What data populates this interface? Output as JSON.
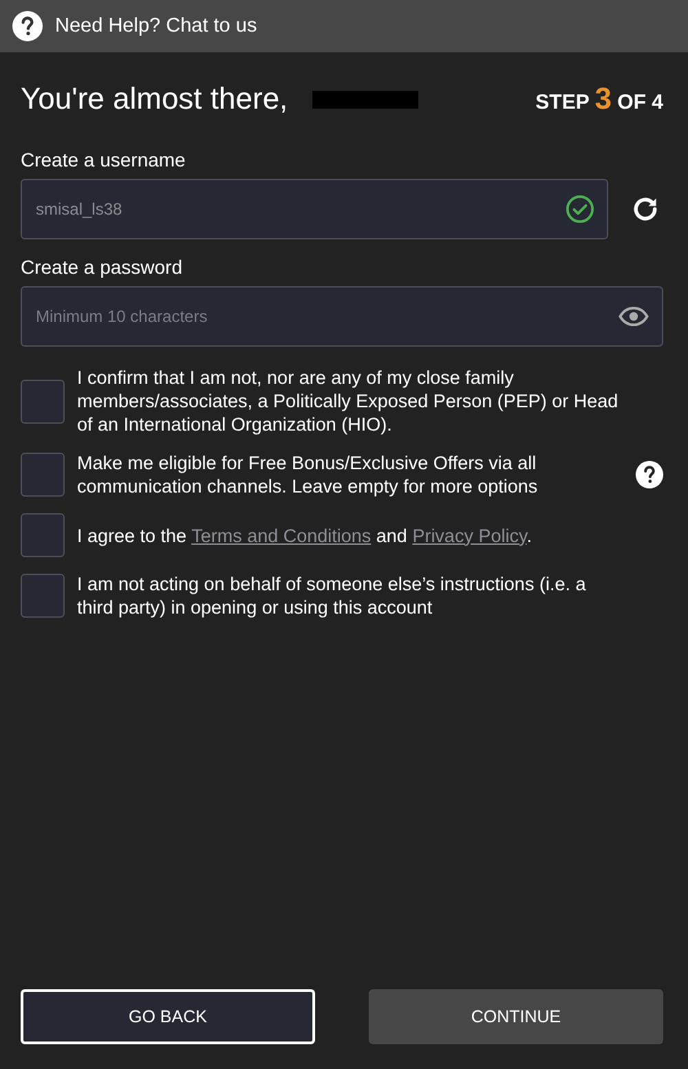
{
  "help_bar": {
    "label": "Need Help? Chat to us"
  },
  "heading": {
    "greeting": "You're almost there,",
    "name_redacted": true,
    "step_prefix": "STEP",
    "step_current": "3",
    "step_suffix": "OF 4"
  },
  "username": {
    "label": "Create a username",
    "value": "smisal_ls38",
    "valid": true
  },
  "password": {
    "label": "Create a password",
    "placeholder": "Minimum 10 characters"
  },
  "checkboxes": [
    {
      "checked": false,
      "help": false,
      "parts": [
        {
          "kind": "text",
          "text": "I confirm that I am not, nor are any of my close family members/associates, a Politically Exposed Person (PEP) or Head of an International Organization (HIO)."
        }
      ]
    },
    {
      "checked": false,
      "help": true,
      "parts": [
        {
          "kind": "text",
          "text": "Make me eligible for Free Bonus/Exclusive Offers via all communication channels. Leave empty for more options"
        }
      ]
    },
    {
      "checked": false,
      "help": false,
      "parts": [
        {
          "kind": "text",
          "text": "I agree to the "
        },
        {
          "kind": "link",
          "text": "Terms and Conditions"
        },
        {
          "kind": "text",
          "text": " and "
        },
        {
          "kind": "link",
          "text": "Privacy Policy"
        },
        {
          "kind": "text",
          "text": "."
        }
      ]
    },
    {
      "checked": false,
      "help": false,
      "parts": [
        {
          "kind": "text",
          "text": "I am not acting on behalf of someone else’s instructions (i.e. a third party) in opening or using this account"
        }
      ]
    }
  ],
  "buttons": [
    {
      "label": "GO BACK",
      "kind": "secondary"
    },
    {
      "label": "CONTINUE",
      "kind": "primary"
    }
  ]
}
